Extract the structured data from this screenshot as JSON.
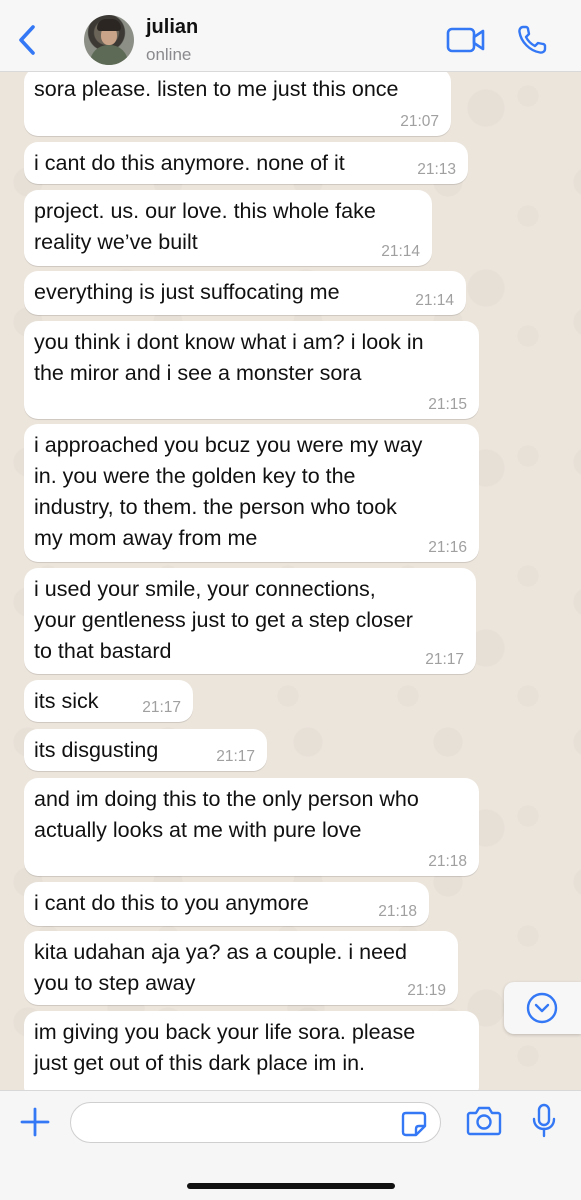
{
  "header": {
    "contact_name": "julian",
    "status": "online"
  },
  "messages": [
    {
      "text": "sora please. listen to me just this once",
      "time": "21:07"
    },
    {
      "text": "i cant do this anymore. none of it",
      "time": "21:13"
    },
    {
      "text": "project. us. our love. this whole fake\nreality we’ve built",
      "time": "21:14"
    },
    {
      "text": "everything is just suffocating me",
      "time": "21:14"
    },
    {
      "text": "you think i dont know what i am? i look in\nthe miror and i see a monster sora",
      "time": "21:15"
    },
    {
      "text": "i approached you bcuz you were my way\nin. you were the golden key to the\nindustry, to them. the person who took\nmy mom away from me",
      "time": "21:16"
    },
    {
      "text": "i used your smile, your connections,\nyour gentleness just to get a step closer\nto that bastard",
      "time": "21:17"
    },
    {
      "text": "its sick",
      "time": "21:17"
    },
    {
      "text": "its disgusting",
      "time": "21:17"
    },
    {
      "text": "and im doing this to the only person who\nactually looks at me with pure love",
      "time": "21:18"
    },
    {
      "text": "i cant do this to you anymore",
      "time": "21:18"
    },
    {
      "text": "kita udahan aja ya? as a couple. i need\nyou to step away",
      "time": "21:19"
    },
    {
      "text": "im giving you back your life sora. please\njust get out of this dark place im in.",
      "time": ""
    }
  ],
  "input": {
    "value": "",
    "placeholder": ""
  },
  "colors": {
    "accent": "#3478f6",
    "chat_background": "#ece5dc",
    "bubble": "#ffffff",
    "timestamp": "#a0a0a0"
  },
  "icons": {
    "back": "chevron-left-icon",
    "video": "video-camera-icon",
    "call": "phone-icon",
    "scroll_down": "chevron-down-circle-icon",
    "attach": "plus-icon",
    "sticker": "sticker-icon",
    "camera": "camera-icon",
    "mic": "microphone-icon"
  }
}
